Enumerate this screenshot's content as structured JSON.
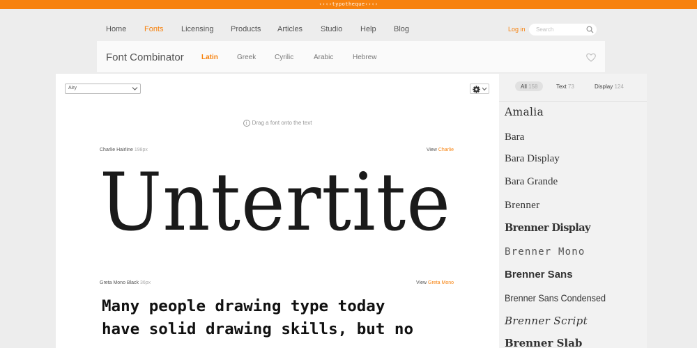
{
  "topbar": {
    "brand": "‹›‹›typotheque‹›‹›"
  },
  "nav": {
    "items": [
      {
        "label": "Home",
        "active": false
      },
      {
        "label": "Fonts",
        "active": true
      },
      {
        "label": "Licensing",
        "active": false
      },
      {
        "label": "Products",
        "active": false
      },
      {
        "label": "Articles",
        "active": false
      },
      {
        "label": "Studio",
        "active": false
      },
      {
        "label": "Help",
        "active": false
      },
      {
        "label": "Blog",
        "active": false
      }
    ],
    "login": "Log in",
    "search_placeholder": "Search"
  },
  "subbar": {
    "title": "Font Combinator",
    "tabs": [
      {
        "label": "Latin",
        "active": true
      },
      {
        "label": "Greek",
        "active": false
      },
      {
        "label": "Cyrilic",
        "active": false
      },
      {
        "label": "Arabic",
        "active": false
      },
      {
        "label": "Hebrew",
        "active": false
      }
    ]
  },
  "canvas": {
    "preset": "Airy",
    "hint": "Drag a font onto the text",
    "block1": {
      "font": "Charlie Hairline",
      "size": "198px",
      "view_prefix": "View",
      "view_link": "Charlie",
      "text": "Untertite"
    },
    "block2": {
      "font": "Greta Mono Black",
      "size": "36px",
      "view_prefix": "View",
      "view_link": "Greta Mono",
      "text": "Many people drawing type today\nhave solid drawing skills, but no"
    }
  },
  "sidebar": {
    "filters": [
      {
        "label": "All",
        "count": "158",
        "active": true
      },
      {
        "label": "Text",
        "count": "73",
        "active": false
      },
      {
        "label": "Display",
        "count": "124",
        "active": false
      }
    ],
    "fonts": [
      "Amalia",
      "Bara",
      "Bara Display",
      "Bara Grande",
      "Brenner",
      "Brenner Display",
      "Brenner Mono",
      "Brenner Sans",
      "Brenner Sans Condensed",
      "Brenner Script",
      "Brenner Slab"
    ]
  },
  "colors": {
    "accent": "#f7820e",
    "topbar": "#f7820e",
    "background": "#ededed"
  }
}
